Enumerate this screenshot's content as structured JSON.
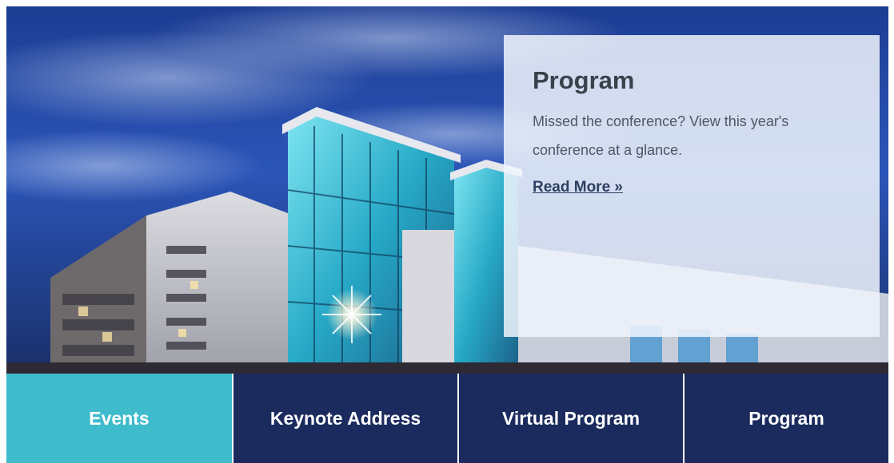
{
  "hero": {
    "card": {
      "title": "Program",
      "description": "Missed the conference? View this year's conference at a glance.",
      "link_label": "Read More »"
    }
  },
  "tabs": [
    {
      "label": "Events",
      "active": true
    },
    {
      "label": "Keynote Address",
      "active": false
    },
    {
      "label": "Virtual Program",
      "active": false
    },
    {
      "label": "Program",
      "active": false
    }
  ],
  "colors": {
    "active_tab": "#3fbccb",
    "inactive_tab": "#1b2b5e",
    "sky_top": "#1f3f94",
    "card_overlay": "#f0f4fc"
  }
}
